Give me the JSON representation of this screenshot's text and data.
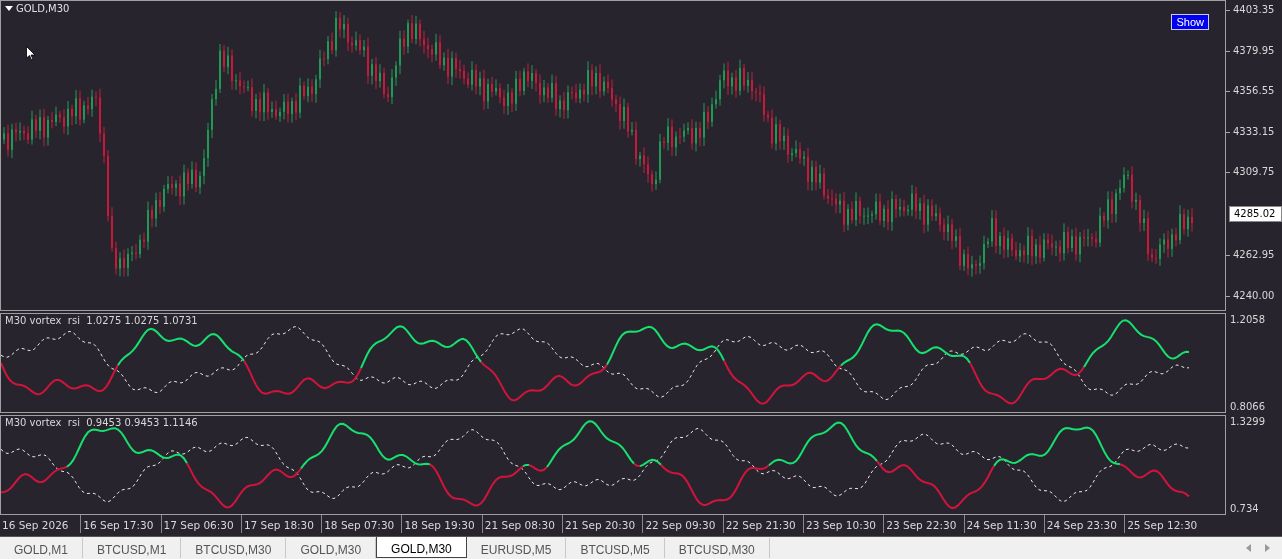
{
  "chart": {
    "title": "GOLD,M30",
    "show_button": "Show",
    "price_axis": [
      {
        "label": "4403.35",
        "kind": "tick"
      },
      {
        "label": "4379.95",
        "kind": "tick"
      },
      {
        "label": "4356.55",
        "kind": "tick"
      },
      {
        "label": "4333.15",
        "kind": "tick"
      },
      {
        "label": "4309.75",
        "kind": "tick"
      },
      {
        "label": "4285.02",
        "kind": "current"
      },
      {
        "label": "4262.95",
        "kind": "tick"
      },
      {
        "label": "4240.00",
        "kind": "tick"
      }
    ]
  },
  "indicators": [
    {
      "label": "M30 vortex  rsi  1.0275 1.0275 1.0731",
      "axis": [
        "1.2058",
        "0.8066"
      ]
    },
    {
      "label": "M30 vortex  rsi  0.9453 0.9453 1.1146",
      "axis": [
        "1.3299",
        "0.734"
      ]
    }
  ],
  "time_axis": [
    "16 Sep 2026",
    "16 Sep 17:30",
    "17 Sep 06:30",
    "17 Sep 18:30",
    "18 Sep 07:30",
    "18 Sep 19:30",
    "21 Sep 08:30",
    "21 Sep 20:30",
    "22 Sep 09:30",
    "22 Sep 21:30",
    "23 Sep 10:30",
    "23 Sep 22:30",
    "24 Sep 11:30",
    "24 Sep 23:30",
    "25 Sep 12:30"
  ],
  "tabs": [
    {
      "label": "GOLD,M1",
      "selected": false
    },
    {
      "label": "BTCUSD,M1",
      "selected": false
    },
    {
      "label": "BTCUSD,M30",
      "selected": false
    },
    {
      "label": "GOLD,M30",
      "selected": false
    },
    {
      "label": "GOLD,M30",
      "selected": true
    },
    {
      "label": "EURUSD,M5",
      "selected": false
    },
    {
      "label": "BTCUSD,M5",
      "selected": false
    },
    {
      "label": "BTCUSD,M30",
      "selected": false
    }
  ]
}
